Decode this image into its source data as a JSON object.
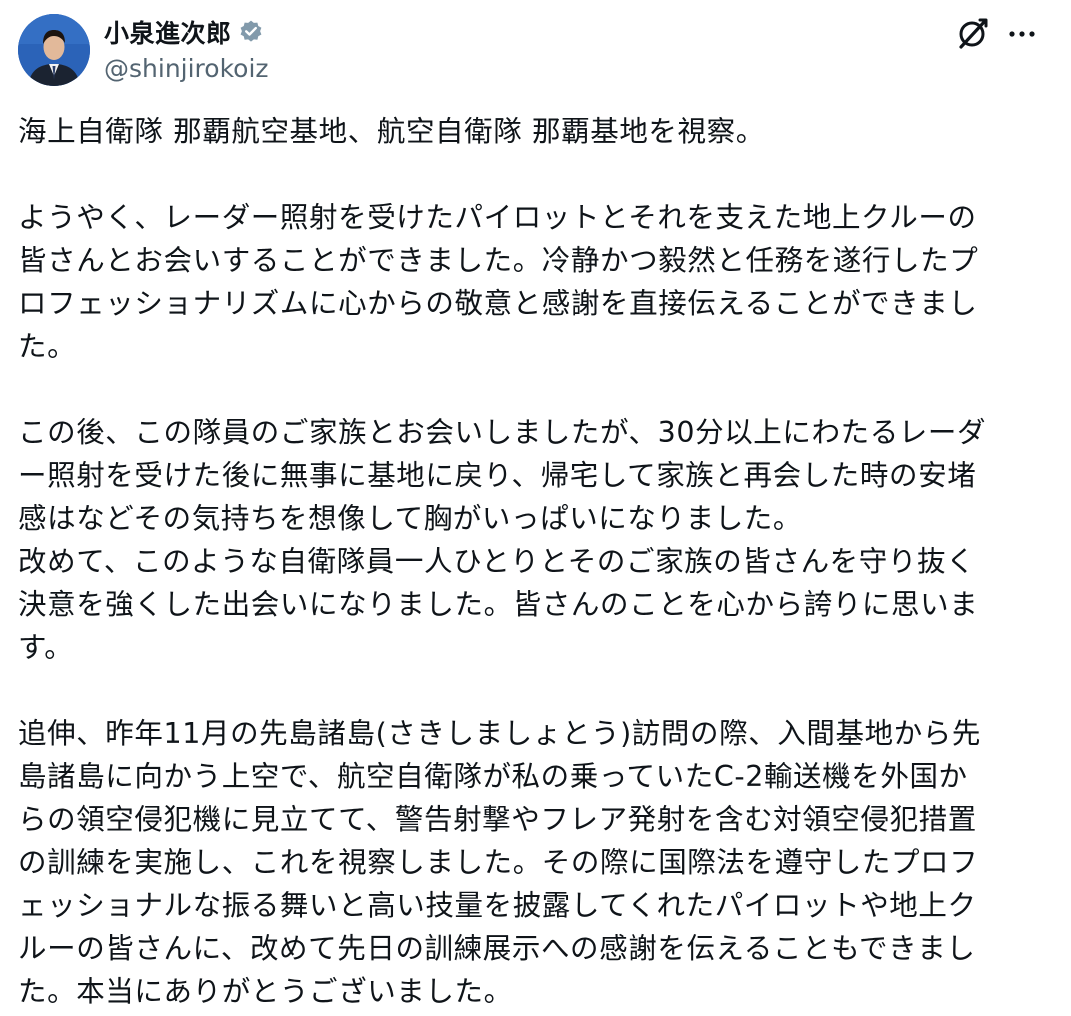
{
  "author": {
    "display_name": "小泉進次郎",
    "handle": "@shinjirokoiz",
    "verified_icon": "verified-badge-icon",
    "avatar_icon": "profile-avatar"
  },
  "header_actions": {
    "grok_icon": "grok-icon",
    "more_icon": "more-options-icon"
  },
  "colors": {
    "text": "#0f1419",
    "secondary": "#536471",
    "verified_badge": "#829aab",
    "avatar_background": "#2b63b8"
  },
  "tweet": {
    "paragraphs": [
      {
        "lines": [
          "海上自衛隊 那覇航空基地、航空自衛隊 那覇基地を視察。"
        ]
      },
      {
        "lines": [
          "ようやく、レーダー照射を受けたパイロットとそれを支えた地上クルーの",
          "皆さんとお会いすることができました。冷静かつ毅然と任務を遂行したプ",
          "ロフェッショナリズムに心からの敬意と感謝を直接伝えることができまし",
          "た。"
        ]
      },
      {
        "lines": [
          "この後、この隊員のご家族とお会いしましたが、30分以上にわたるレーダ",
          "ー照射を受けた後に無事に基地に戻り、帰宅して家族と再会した時の安堵",
          "感はなどその気持ちを想像して胸がいっぱいになりました。",
          "改めて、このような自衛隊員一人ひとりとそのご家族の皆さんを守り抜く",
          "決意を強くした出会いになりました。皆さんのことを心から誇りに思いま",
          "す。"
        ]
      },
      {
        "lines": [
          "追伸、昨年11月の先島諸島(さきしましょとう)訪問の際、入間基地から先",
          "島諸島に向かう上空で、航空自衛隊が私の乗っていたC-2輸送機を外国か",
          "らの領空侵犯機に見立てて、警告射撃やフレア発射を含む対領空侵犯措置",
          "の訓練を実施し、これを視察しました。その際に国際法を遵守したプロフ",
          "ェッショナルな振る舞いと高い技量を披露してくれたパイロットや地上ク",
          "ルーの皆さんに、改めて先日の訓練展示への感謝を伝えることもできまし",
          "た。本当にありがとうございました。"
        ]
      }
    ]
  }
}
